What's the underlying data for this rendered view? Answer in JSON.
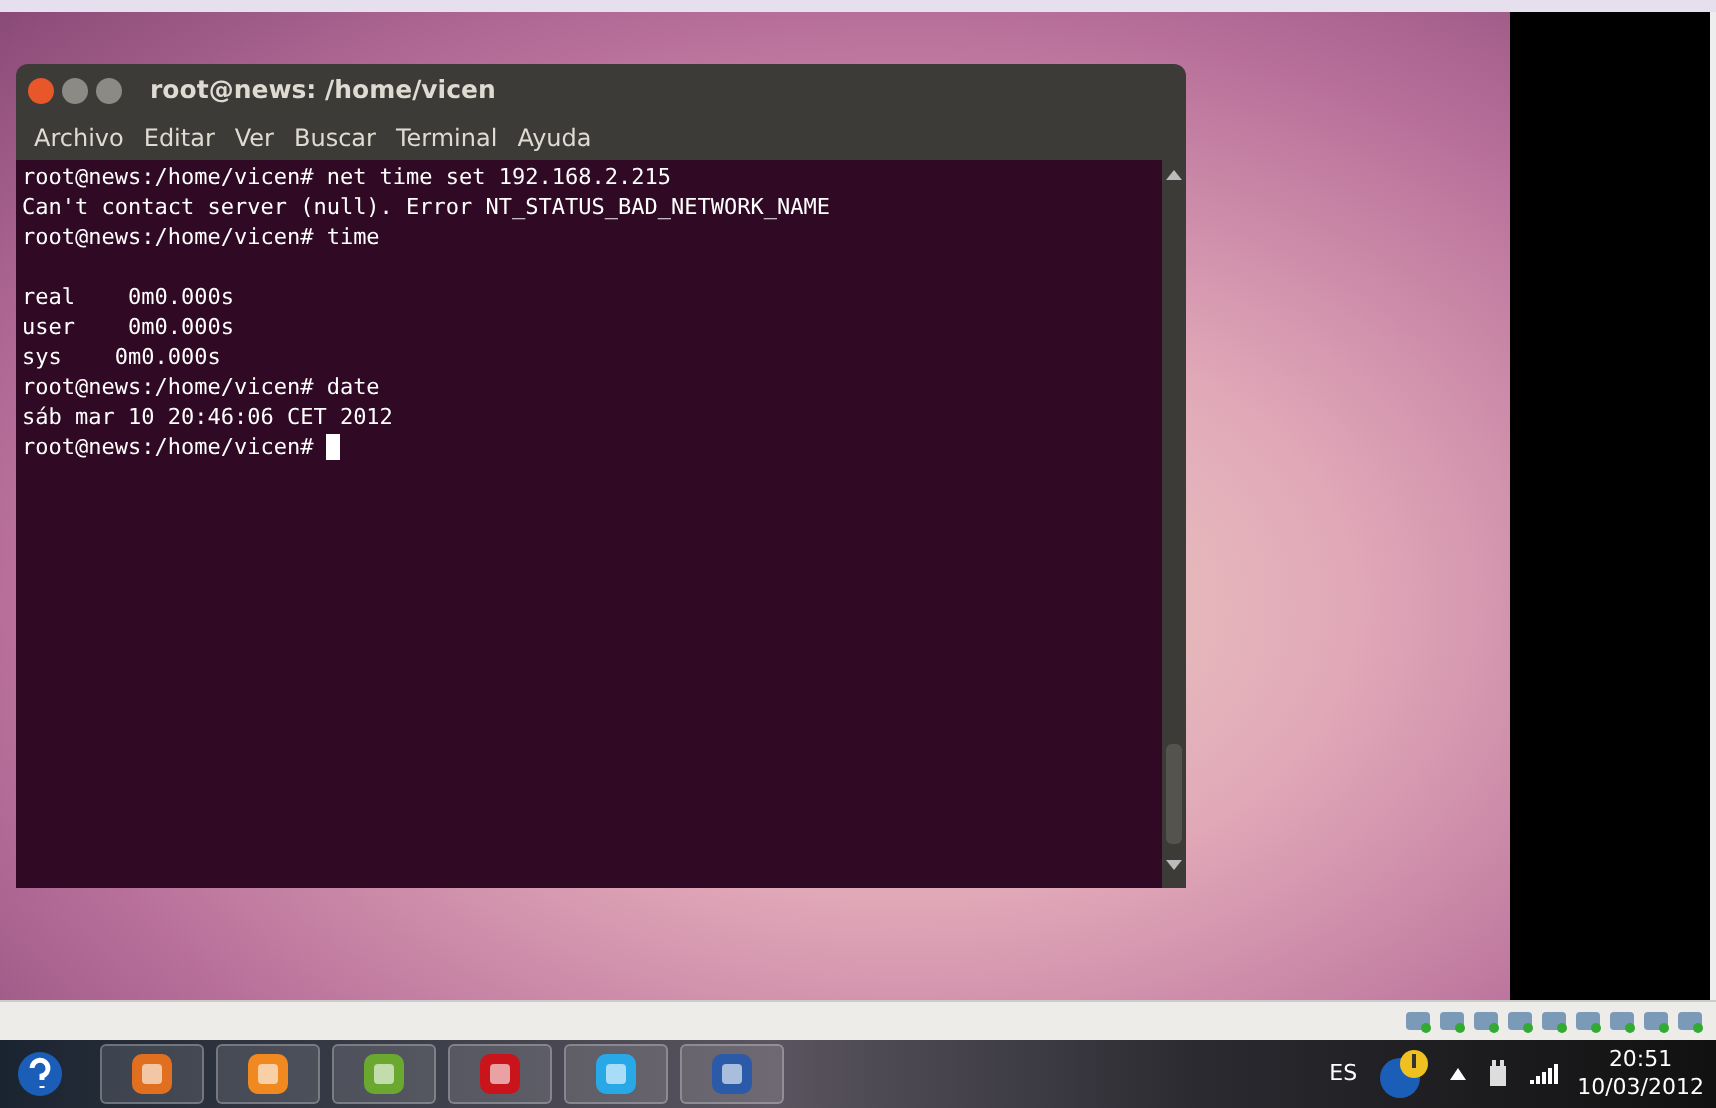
{
  "terminal": {
    "title": "root@news: /home/vicen",
    "menu": [
      "Archivo",
      "Editar",
      "Ver",
      "Buscar",
      "Terminal",
      "Ayuda"
    ],
    "lines": [
      {
        "kind": "command",
        "text": "root@news:/home/vicen# net time set 192.168.2.215"
      },
      {
        "kind": "output",
        "text": "Can't contact server (null). Error NT_STATUS_BAD_NETWORK_NAME"
      },
      {
        "kind": "command",
        "text": "root@news:/home/vicen# time"
      },
      {
        "kind": "blank"
      },
      {
        "kind": "output",
        "text": "real\t0m0.000s"
      },
      {
        "kind": "output",
        "text": "user\t0m0.000s"
      },
      {
        "kind": "output",
        "text": "sys\t0m0.000s"
      },
      {
        "kind": "command",
        "text": "root@news:/home/vicen# date"
      },
      {
        "kind": "output",
        "text": "sáb mar 10 20:46:06 CET 2012"
      },
      {
        "kind": "prompt",
        "text": "root@news:/home/vicen# "
      }
    ]
  },
  "taskbar": {
    "language": "ES",
    "time": "20:51",
    "date": "10/03/2012"
  }
}
